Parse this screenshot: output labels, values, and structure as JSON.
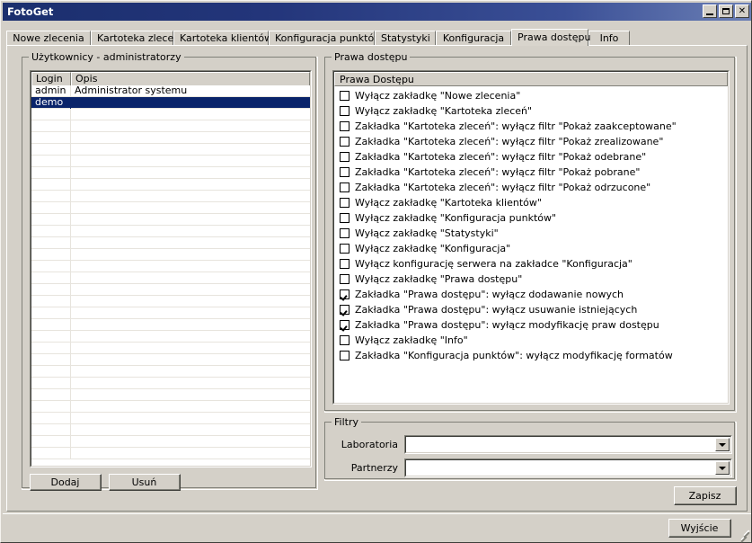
{
  "window": {
    "title": "FotoGet",
    "buttons": {
      "minimize": "minimize-icon",
      "maximize": "maximize-icon",
      "close": "✕"
    },
    "colors": {
      "face": "#d4d0c8",
      "title_start": "#1b2f6e",
      "title_end": "#6b7fb5",
      "selection": "#0a246a",
      "shadow": "#808078",
      "highlight": "#ffffff"
    }
  },
  "tabs": [
    {
      "label": "Nowe zlecenia",
      "active": false
    },
    {
      "label": "Kartoteka zleceń",
      "active": false
    },
    {
      "label": "Kartoteka klientów",
      "active": false
    },
    {
      "label": "Konfiguracja punktów",
      "active": false
    },
    {
      "label": "Statystyki",
      "active": false
    },
    {
      "label": "Konfiguracja",
      "active": false
    },
    {
      "label": "Prawa dostępu",
      "active": true
    },
    {
      "label": "Info",
      "active": false
    }
  ],
  "users_panel": {
    "group_label": "Użytkownicy - administratorzy",
    "columns": [
      "Login",
      "Opis"
    ],
    "rows": [
      {
        "login": "admin",
        "opis": "Administrator systemu",
        "selected": false
      },
      {
        "login": "demo",
        "opis": "",
        "selected": true
      }
    ],
    "empty_row_count": 30,
    "add_button": "Dodaj",
    "delete_button": "Usuń"
  },
  "rights_panel": {
    "group_label": "Prawa dostępu",
    "list_header": "Prawa Dostępu",
    "items": [
      {
        "label": "Wyłącz zakładkę \"Nowe zlecenia\"",
        "checked": false
      },
      {
        "label": "Wyłącz zakładkę \"Kartoteka zleceń\"",
        "checked": false
      },
      {
        "label": "Zakładka \"Kartoteka zleceń\": wyłącz filtr \"Pokaż zaakceptowane\"",
        "checked": false
      },
      {
        "label": "Zakładka \"Kartoteka zleceń\": wyłącz filtr \"Pokaż zrealizowane\"",
        "checked": false
      },
      {
        "label": "Zakładka \"Kartoteka zleceń\": wyłącz filtr \"Pokaż odebrane\"",
        "checked": false
      },
      {
        "label": "Zakładka \"Kartoteka zleceń\": wyłącz filtr \"Pokaż pobrane\"",
        "checked": false
      },
      {
        "label": "Zakładka \"Kartoteka zleceń\": wyłącz filtr \"Pokaż odrzucone\"",
        "checked": false
      },
      {
        "label": "Wyłącz zakładkę \"Kartoteka klientów\"",
        "checked": false
      },
      {
        "label": "Wyłącz zakładkę \"Konfiguracja punktów\"",
        "checked": false
      },
      {
        "label": "Wyłącz zakładkę \"Statystyki\"",
        "checked": false
      },
      {
        "label": "Wyłącz zakładkę \"Konfiguracja\"",
        "checked": false
      },
      {
        "label": "Wyłącz konfigurację serwera na zakładce \"Konfiguracja\"",
        "checked": false
      },
      {
        "label": "Wyłącz zakładkę \"Prawa dostępu\"",
        "checked": false
      },
      {
        "label": "Zakładka \"Prawa dostępu\": wyłącz dodawanie nowych",
        "checked": true
      },
      {
        "label": "Zakładka \"Prawa dostępu\": wyłącz usuwanie istniejących",
        "checked": true
      },
      {
        "label": "Zakładka \"Prawa dostępu\": wyłącz modyfikację praw dostępu",
        "checked": true
      },
      {
        "label": "Wyłącz zakładkę \"Info\"",
        "checked": false
      },
      {
        "label": "Zakładka \"Konfiguracja punktów\": wyłącz modyfikację formatów",
        "checked": false
      }
    ]
  },
  "filters_panel": {
    "group_label": "Filtry",
    "fields": [
      {
        "label": "Laboratoria",
        "value": "",
        "placeholder": ""
      },
      {
        "label": "Partnerzy",
        "value": "",
        "placeholder": ""
      }
    ]
  },
  "actions": {
    "save": "Zapisz",
    "exit": "Wyjście"
  }
}
